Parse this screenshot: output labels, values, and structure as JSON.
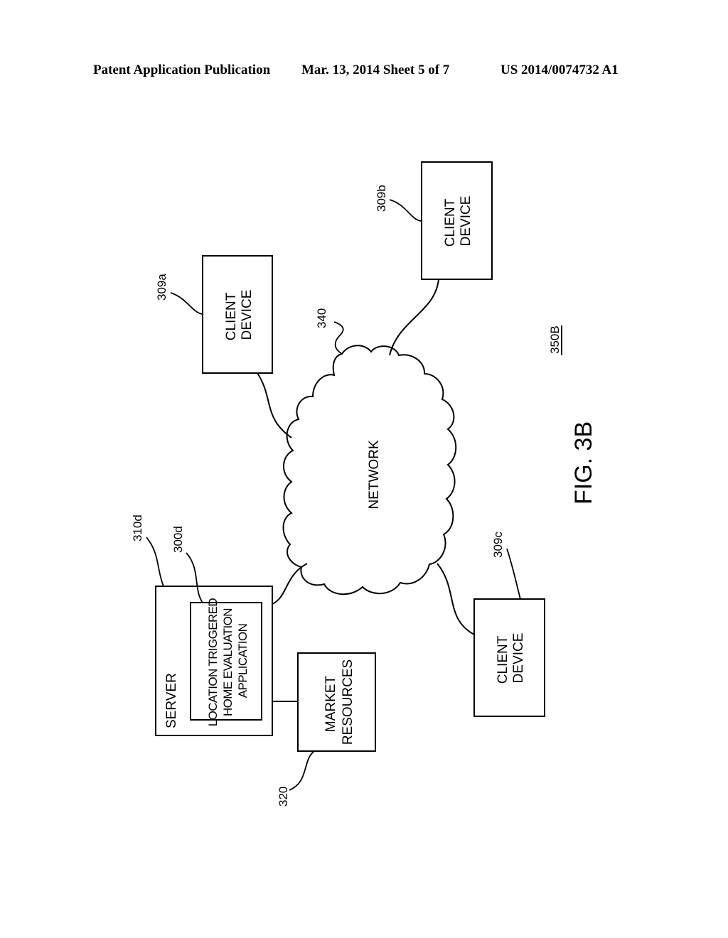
{
  "header": {
    "publication": "Patent Application Publication",
    "date_sheet": "Mar. 13, 2014  Sheet 5 of 7",
    "patent_number": "US 2014/0074732 A1"
  },
  "figure": {
    "label": "FIG. 3B",
    "system_ref": "350B"
  },
  "network": {
    "label": "NETWORK",
    "ref": "340"
  },
  "server": {
    "label": "SERVER",
    "ref": "310d",
    "application": {
      "lines": [
        "LOCATION TRIGGERED",
        "HOME EVALUATION",
        "APPLICATION"
      ],
      "ref": "300d"
    }
  },
  "market_resources": {
    "lines": [
      "MARKET",
      "RESOURCES"
    ],
    "ref": "320"
  },
  "client_devices": [
    {
      "lines": [
        "CLIENT",
        "DEVICE"
      ],
      "ref": "309a"
    },
    {
      "lines": [
        "CLIENT",
        "DEVICE"
      ],
      "ref": "309b"
    },
    {
      "lines": [
        "CLIENT",
        "DEVICE"
      ],
      "ref": "309c"
    }
  ]
}
